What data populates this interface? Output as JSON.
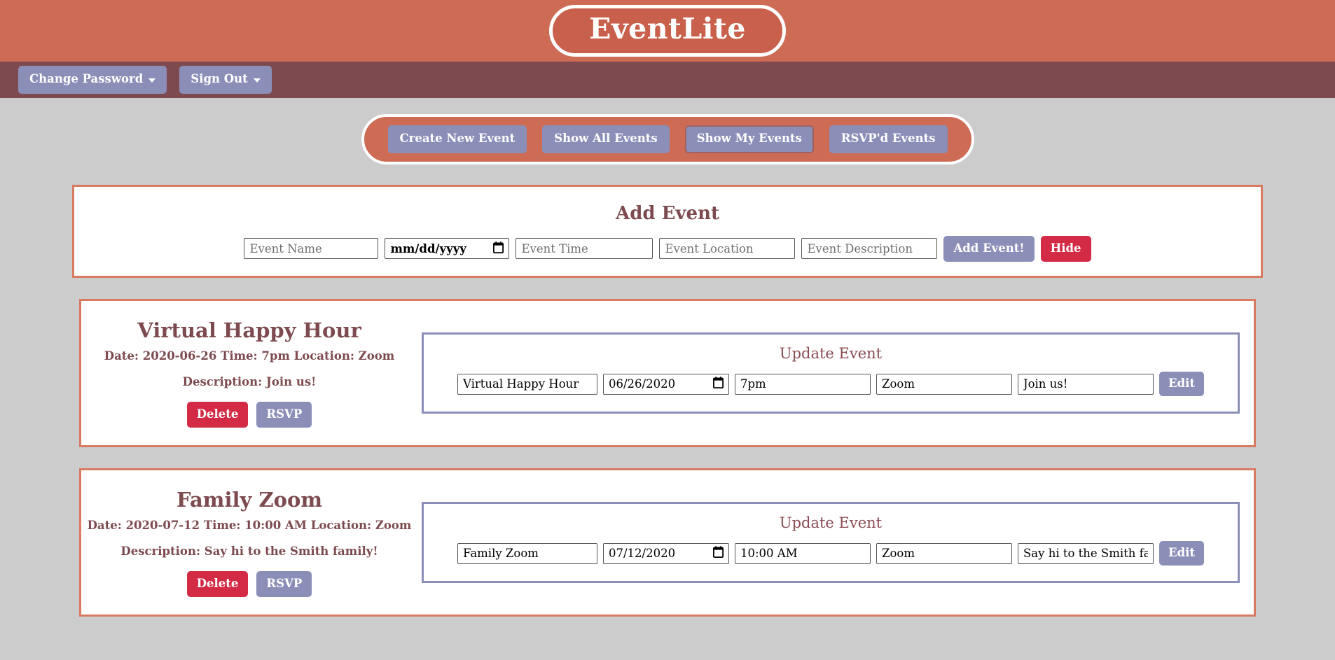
{
  "header": {
    "app_title": "EventLite",
    "brand_color": "#cd6b55",
    "title_pill_fill": "#c9604c"
  },
  "navbar": {
    "background_color": "#7d4b4f",
    "items": [
      {
        "label": "Change Password",
        "has_caret": true
      },
      {
        "label": "Sign Out",
        "has_caret": true
      }
    ]
  },
  "nav_pill": {
    "buttons": [
      {
        "label": "Create New Event",
        "active": false
      },
      {
        "label": "Show All Events",
        "active": false
      },
      {
        "label": "Show My Events",
        "active": true
      },
      {
        "label": "RSVP'd Events",
        "active": false
      }
    ],
    "button_color": "#8b8fb8"
  },
  "add_event": {
    "title": "Add Event",
    "fields": {
      "name_placeholder": "Event Name",
      "date_placeholder": "mm/dd/yyyy",
      "time_placeholder": "Event Time",
      "location_placeholder": "Event Location",
      "description_placeholder": "Event Description"
    },
    "submit_label": "Add Event!",
    "hide_label": "Hide",
    "submit_color": "#8b8fb8",
    "hide_color": "#d32a46"
  },
  "events": [
    {
      "name": "Virtual Happy Hour",
      "meta": "Date: 2020-06-26 Time: 7pm Location: Zoom",
      "description": "Description: Join us!",
      "delete_label": "Delete",
      "rsvp_label": "RSVP",
      "update": {
        "title": "Update Event",
        "name_value": "Virtual Happy Hour",
        "date_value": "06/26/2020",
        "time_value": "7pm",
        "location_value": "Zoom",
        "description_value": "Join us!",
        "edit_label": "Edit"
      }
    },
    {
      "name": "Family Zoom",
      "meta": "Date: 2020-07-12 Time: 10:00 AM Location: Zoom",
      "description": "Description: Say hi to the Smith family!",
      "delete_label": "Delete",
      "rsvp_label": "RSVP",
      "update": {
        "title": "Update Event",
        "name_value": "Family Zoom",
        "date_value": "07/12/2020",
        "time_value": "10:00 AM",
        "location_value": "Zoom",
        "description_value": "Say hi to the Smith family!",
        "edit_label": "Edit"
      }
    }
  ],
  "icons": {
    "caret": "chevron-down-icon",
    "calendar": "calendar-icon"
  }
}
